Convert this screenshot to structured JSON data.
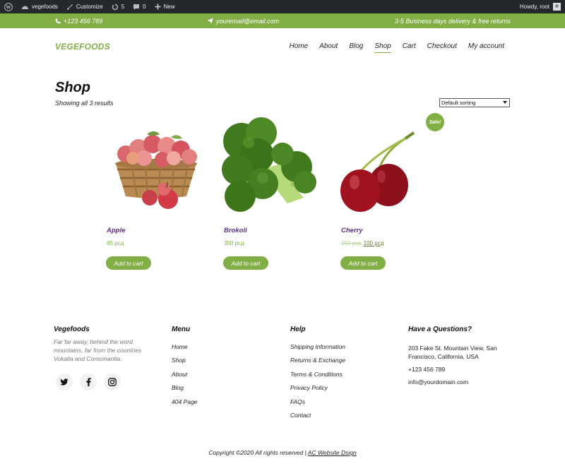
{
  "adminbar": {
    "site_name": "vegefoods",
    "customize": "Customize",
    "updates_count": "5",
    "comments_count": "0",
    "new_label": "New",
    "greeting": "Howdy, root"
  },
  "topbar": {
    "phone": "+123 456 789",
    "email": "youremail@email.com",
    "delivery": "3-5 Business days delivery & free returns"
  },
  "header": {
    "logo": "VEGEFOODS",
    "nav": [
      "Home",
      "About",
      "Blog",
      "Shop",
      "Cart",
      "Checkout",
      "My account"
    ],
    "active_nav": "Shop"
  },
  "shop": {
    "title": "Shop",
    "results": "Showing all 3 results",
    "sort_selected": "Default sorting"
  },
  "products": [
    {
      "name": "Apple",
      "price": "85 рсд",
      "button": "Add to cart"
    },
    {
      "name": "Brokoli",
      "price": "350 рсд",
      "button": "Add to cart"
    },
    {
      "name": "Cherry",
      "old_price": "150 рсд",
      "price": "100 рсд",
      "button": "Add to cart",
      "badge": "Sale!"
    }
  ],
  "footer": {
    "about_title": "Vegefoods",
    "about_text": "Far far away, behind the word mountains, far from the countries Vokalia and Consonantia.",
    "menu_title": "Menu",
    "menu": [
      "Home",
      "Shop",
      "About",
      "Blog",
      "404 Page"
    ],
    "help_title": "Help",
    "help": [
      "Shipping Information",
      "Returns & Exchange",
      "Terms & Conditions",
      "Privacy Policy",
      "FAQs",
      "Contact"
    ],
    "contact_title": "Have a Questions?",
    "address": "203 Fake St. Mountain View, San Francisco, California, USA",
    "phone": "+123 456 789",
    "email": "info@yourdomain.com",
    "copyright_prefix": "Copyright ©2020 All rights reserved | ",
    "copyright_link": "AC Website Dsign"
  },
  "colors": {
    "brand": "#82ae46",
    "adminbar": "#23282d",
    "product_name": "#5a2f86"
  }
}
